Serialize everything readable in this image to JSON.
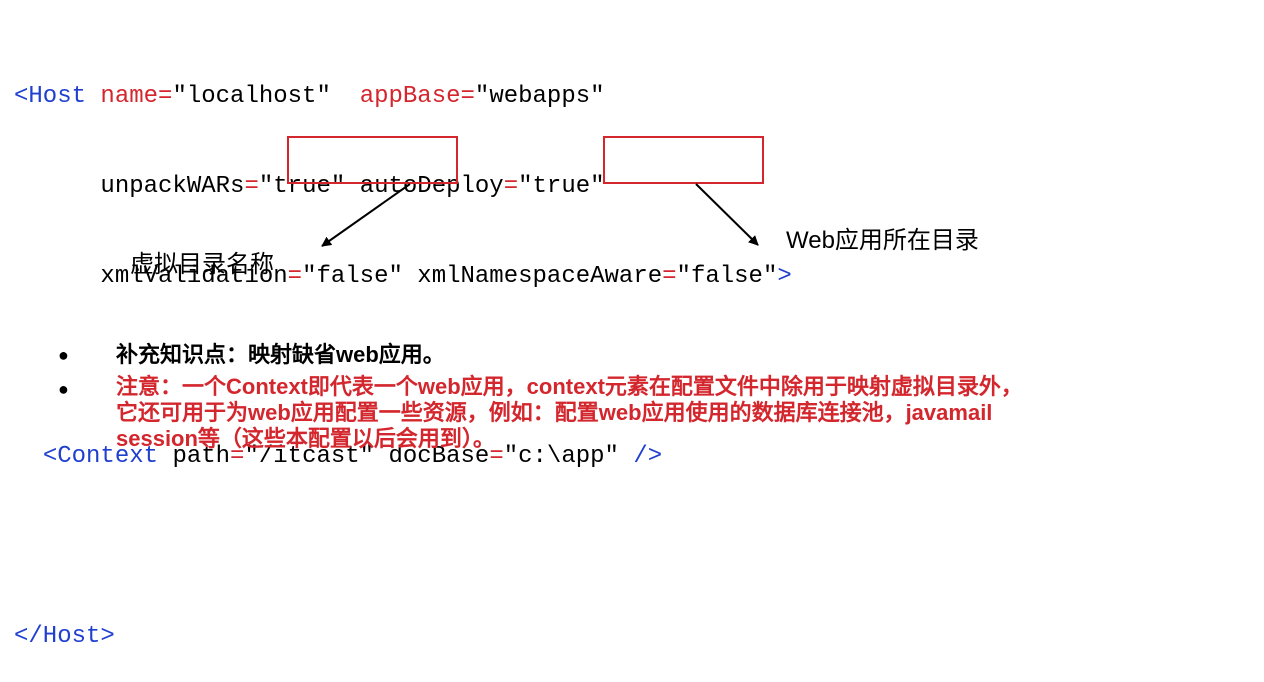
{
  "code": {
    "line1": {
      "open": "<Host",
      "a1": "name",
      "eq1": "=",
      "v1": "\"localhost\"",
      "a2": "appBase",
      "eq2": "=",
      "v2": "\"webapps\""
    },
    "line2": {
      "a1": "unpackWARs",
      "eq1": "=",
      "v1": "\"true\"",
      "a2": "autoDeploy",
      "eq2": "=",
      "v2": "\"true\""
    },
    "line3": {
      "a1": "xmlValidation",
      "eq1": "=",
      "v1": "\"false\"",
      "a2": "xmlNamespaceAware",
      "eq2": "=",
      "v2": "\"false\"",
      "close": ">"
    },
    "line4": {
      "open": "<Context",
      "a1": "path",
      "eq1": "=",
      "v1": "\"/itcast\"",
      "a2": "docBase",
      "eq2": "=",
      "v2": "\"c:\\app\"",
      "close": "/>"
    },
    "line5": {
      "close": "</Host>"
    }
  },
  "annotations": {
    "virtual_dir": "虚拟目录名称",
    "web_dir": "Web应用所在目录"
  },
  "bullets": {
    "item1": "补充知识点：映射缺省web应用。",
    "item2_line1": "注意：一个Context即代表一个web应用，context元素在配置文件中除用于映射虚拟目录外，",
    "item2_line2": "它还可用于为web应用配置一些资源，例如：配置web应用使用的数据库连接池，javamail",
    "item2_line3": "session等（这些本配置以后会用到）。"
  },
  "colors": {
    "tag": "#1f3fcf",
    "attribute": "#d3262d",
    "highlight_box": "#d3262d",
    "note_text": "#d3262d"
  }
}
